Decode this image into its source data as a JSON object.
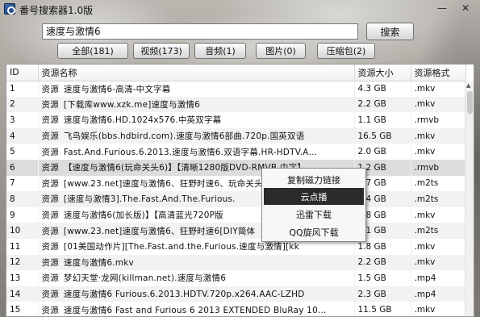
{
  "window": {
    "title": "番号搜索器1.0版",
    "minimize": "—",
    "close": "✕"
  },
  "search": {
    "value": "速度与激情6",
    "button": "搜索"
  },
  "tabs": [
    {
      "label": "全部(181)"
    },
    {
      "label": "视频(173)"
    },
    {
      "label": "音频(1)"
    },
    {
      "label": "图片(0)"
    },
    {
      "label": "压缩包(2)"
    }
  ],
  "table": {
    "headers": {
      "id": "ID",
      "name": "资源名称",
      "size": "资源大小",
      "format": "资源格式"
    },
    "rows": [
      {
        "id": "1",
        "src": "资源",
        "name": "速度与激情6-高清-中文字幕",
        "size": "4.3 GB",
        "fmt": ".mkv"
      },
      {
        "id": "2",
        "src": "资源",
        "name": "[下载库www.xzk.me]速度与激情6",
        "size": "2.2 GB",
        "fmt": ".mkv"
      },
      {
        "id": "3",
        "src": "资源",
        "name": "速度与激情6.HD.1024x576.中英双字幕",
        "size": "1.1 GB",
        "fmt": ".rmvb"
      },
      {
        "id": "4",
        "src": "资源",
        "name": "飞鸟娱乐(bbs.hdbird.com).速度与激情6部曲.720p.国英双语",
        "size": "16.5 GB",
        "fmt": ".mkv"
      },
      {
        "id": "5",
        "src": "资源",
        "name": "Fast.And.Furious.6.2013.速度与激情6.双语字幕.HR-HDTV.A…",
        "size": "2.0 GB",
        "fmt": ".mkv"
      },
      {
        "id": "6",
        "src": "资源",
        "name": "【速度与激情6(玩命关头6)】【清晰1280版DVD-RMVB.中字】",
        "size": "1.2 GB",
        "fmt": ".rmvb"
      },
      {
        "id": "7",
        "src": "资源",
        "name": "[www.23.net]速度与激情6、狂野时速6、玩命关头6",
        "size": "3.7 GB",
        "fmt": ".m2ts"
      },
      {
        "id": "8",
        "src": "资源",
        "name": "[速度与激情3].The.Fast.And.The.Furious.",
        "size": "4.4 GB",
        "fmt": ".m2ts"
      },
      {
        "id": "9",
        "src": "资源",
        "name": "速度与激情6(加长版)】【高清蓝光720P版",
        "size": "2.8 GB",
        "fmt": ".mkv"
      },
      {
        "id": "10",
        "src": "资源",
        "name": "[www.23.net]速度与激情6、狂野时速6[DIY简体",
        "size": "1.1 GB",
        "fmt": ".m2ts"
      },
      {
        "id": "11",
        "src": "资源",
        "name": "[01美国动作片][The.Fast.and.the.Furious.速度与激情][kk",
        "size": "1.8 GB",
        "fmt": ".mkv"
      },
      {
        "id": "12",
        "src": "资源",
        "name": "速度与激情6.mkv",
        "size": "2.2 GB",
        "fmt": ".mkv"
      },
      {
        "id": "13",
        "src": "资源",
        "name": "梦幻天堂·龙网(killman.net).速度与激情6",
        "size": "1.5 GB",
        "fmt": ".mp4"
      },
      {
        "id": "14",
        "src": "资源",
        "name": "速度与激情6 Furious.6.2013.HDTV.720p.x264.AAC-LZHD",
        "size": "2.3 GB",
        "fmt": ".mp4"
      },
      {
        "id": "15",
        "src": "资源",
        "name": "速度与激情6 Fast and Furious 6 2013 EXTENDED BluRay 10…",
        "size": "11.5 GB",
        "fmt": ".mkv"
      }
    ]
  },
  "context_menu": {
    "items": [
      {
        "label": "复制磁力链接"
      },
      {
        "label": "云点播"
      },
      {
        "label": "迅雷下载"
      },
      {
        "label": "QQ旋风下载"
      }
    ]
  }
}
